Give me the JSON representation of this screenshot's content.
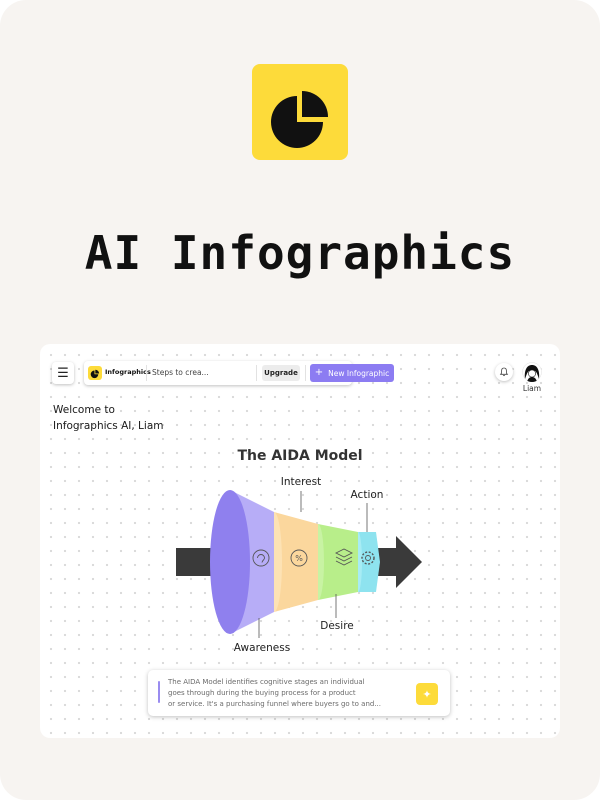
{
  "app": {
    "title": "AI Infographics",
    "logo_icon": "pie-chart-icon",
    "brand_color": "#fddb3a",
    "accent_color": "#8c7cf2"
  },
  "toolbar": {
    "brand": "Infographics",
    "document_title": "Steps to crea...",
    "upgrade_label": "Upgrade",
    "new_label": "New Infographic"
  },
  "user": {
    "name": "Liam"
  },
  "welcome": {
    "line1": "Welcome to",
    "line2": "Infographics AI, Liam"
  },
  "infographic": {
    "title": "The AIDA Model",
    "stages": [
      {
        "label": "Awareness",
        "icon": "ear-icon",
        "color": "#a99ef5"
      },
      {
        "label": "Interest",
        "icon": "percent-icon",
        "color": "#fbd79d"
      },
      {
        "label": "Desire",
        "icon": "layers-icon",
        "color": "#b8ee8a"
      },
      {
        "label": "Action",
        "icon": "gear-icon",
        "color": "#8ee3ef"
      }
    ]
  },
  "description": {
    "line1": "The AIDA Model identifies cognitive stages an individual",
    "line2": "goes through during the buying process for a product",
    "line3": "or service. It's a purchasing funnel where buyers go to and...",
    "action_icon": "sparkle-icon"
  }
}
